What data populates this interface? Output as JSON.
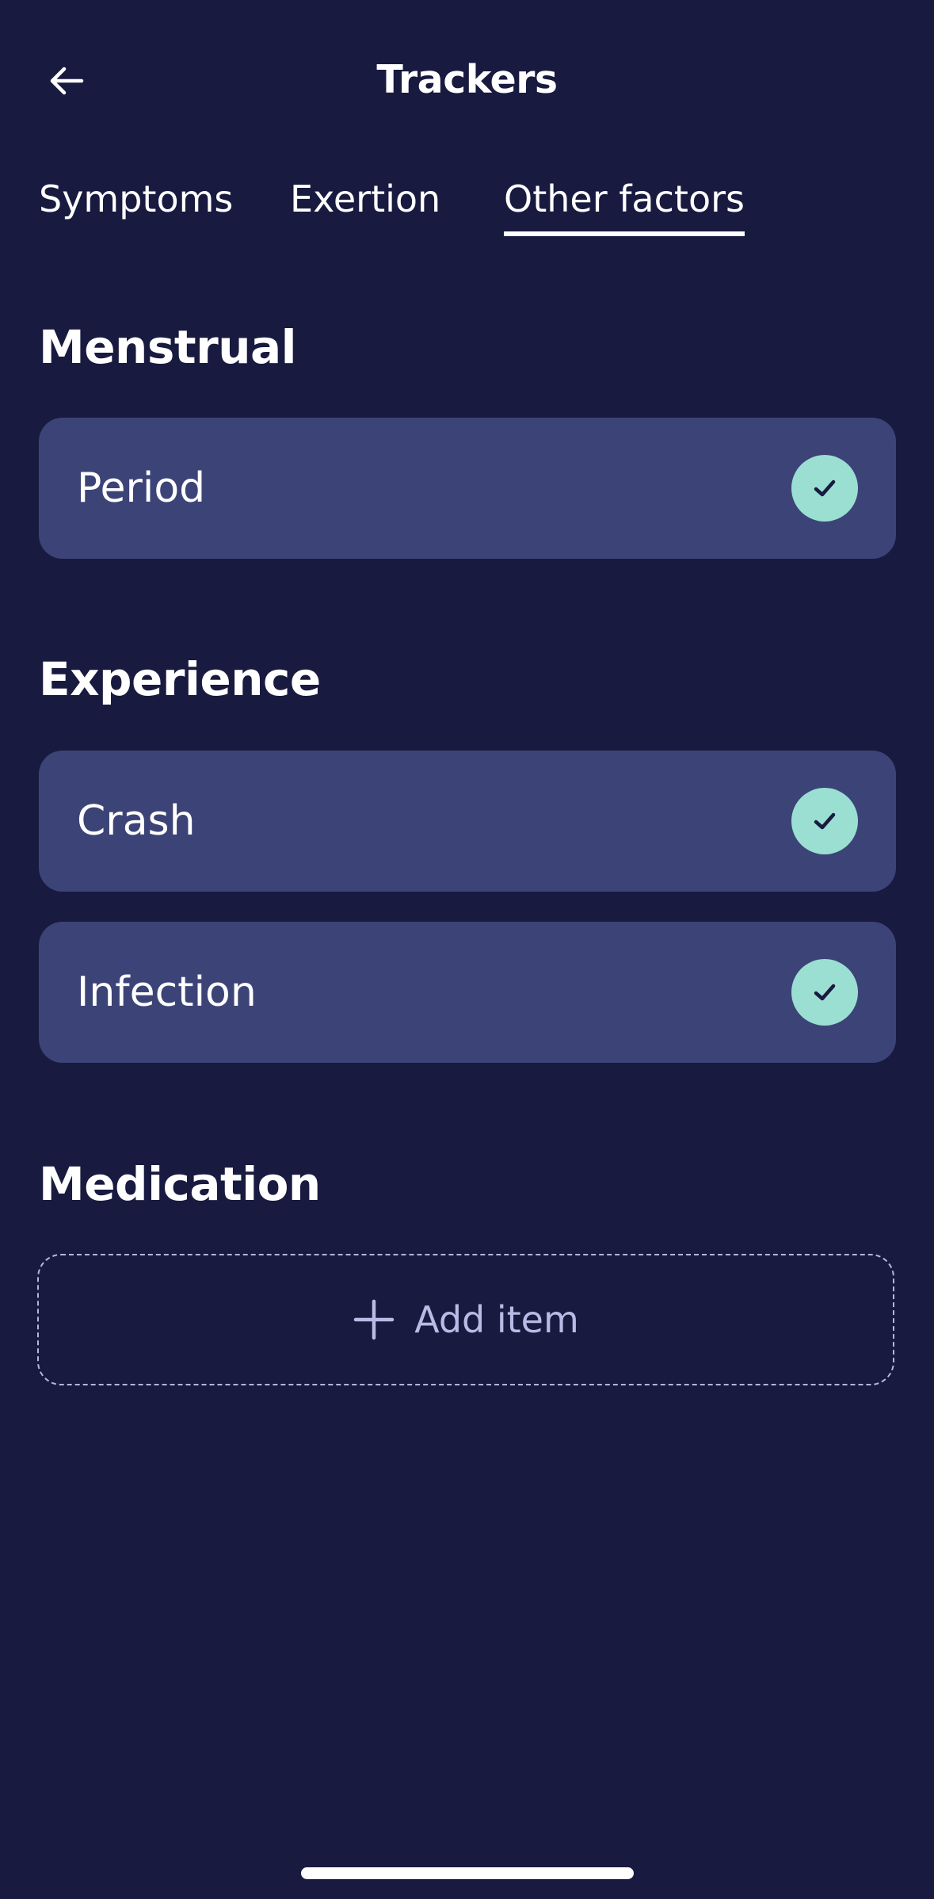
{
  "header": {
    "title": "Trackers"
  },
  "tabs": [
    {
      "label": "Symptoms",
      "active": false
    },
    {
      "label": "Exertion",
      "active": false
    },
    {
      "label": "Other factors",
      "active": true
    }
  ],
  "sections": {
    "menstrual": {
      "title": "Menstrual",
      "items": [
        {
          "label": "Period",
          "checked": true
        }
      ]
    },
    "experience": {
      "title": "Experience",
      "items": [
        {
          "label": "Crash",
          "checked": true
        },
        {
          "label": "Infection",
          "checked": true
        }
      ]
    },
    "medication": {
      "title": "Medication",
      "add_label": "Add item"
    }
  },
  "icons": {
    "back": "arrow-left-icon",
    "check": "checkmark-icon",
    "add": "plus-icon"
  },
  "colors": {
    "background": "#191a40",
    "card": "#3c4477",
    "check_badge": "#9bdfd3",
    "text": "#ffffff",
    "add_text": "#b9bbe6"
  }
}
